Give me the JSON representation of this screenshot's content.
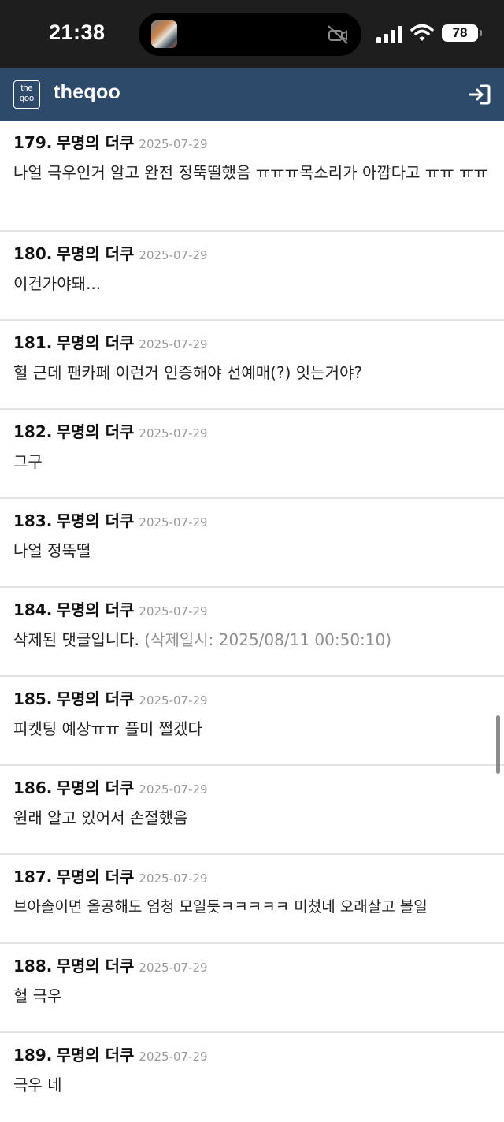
{
  "status_bar": {
    "time": "21:38",
    "battery": "78",
    "icons": [
      "cellular-signal-icon",
      "wifi-icon",
      "battery-icon",
      "muted-camera-icon"
    ]
  },
  "header": {
    "logo_line1": "the",
    "logo_line2": "qoo",
    "brand": "theqoo",
    "login_icon": "sign-in-icon",
    "background": "#2d4a6b"
  },
  "comments": [
    {
      "num": "179.",
      "nick": "무명의 더쿠",
      "date": "2025-07-29",
      "text": "나얼 극우인거 알고 완전 정뚝떨했음 ㅠㅠㅠ목소리가 아깝다고 ㅠㅠ ㅠㅠ"
    },
    {
      "num": "180.",
      "nick": "무명의 더쿠",
      "date": "2025-07-29",
      "text": "이건가야돼..."
    },
    {
      "num": "181.",
      "nick": "무명의 더쿠",
      "date": "2025-07-29",
      "text": "헐 근데 팬카페 이런거 인증해야 선예매(?) 잇는거야?"
    },
    {
      "num": "182.",
      "nick": "무명의 더쿠",
      "date": "2025-07-29",
      "text": "그구"
    },
    {
      "num": "183.",
      "nick": "무명의 더쿠",
      "date": "2025-07-29",
      "text": "나얼 정뚝떨"
    },
    {
      "num": "184.",
      "nick": "무명의 더쿠",
      "date": "2025-07-29",
      "text": "삭제된 댓글입니다.",
      "note": "(삭제일시: 2025/08/11 00:50:10)"
    },
    {
      "num": "185.",
      "nick": "무명의 더쿠",
      "date": "2025-07-29",
      "text": "피켓팅 예상ㅠㅠ 플미 쩔겠다"
    },
    {
      "num": "186.",
      "nick": "무명의 더쿠",
      "date": "2025-07-29",
      "text": "원래 알고 있어서 손절했음"
    },
    {
      "num": "187.",
      "nick": "무명의 더쿠",
      "date": "2025-07-29",
      "text": "브아솔이면 올공해도 엄청 모일듯ㅋㅋㅋㅋㅋ 미쳤네 오래살고 볼일"
    },
    {
      "num": "188.",
      "nick": "무명의 더쿠",
      "date": "2025-07-29",
      "text": "헐 극우"
    },
    {
      "num": "189.",
      "nick": "무명의 더쿠",
      "date": "2025-07-29",
      "text": "극우 네"
    }
  ]
}
